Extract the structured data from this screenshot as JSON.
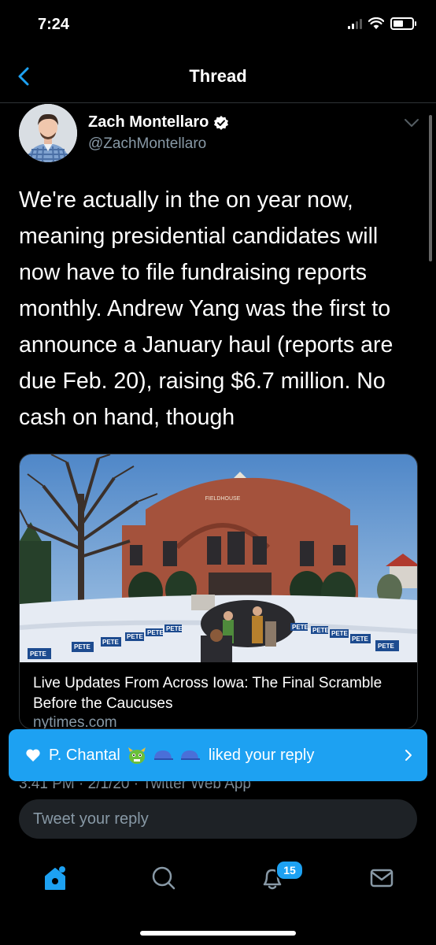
{
  "status_bar": {
    "time": "7:24"
  },
  "nav": {
    "title": "Thread"
  },
  "tweet": {
    "author_name": "Zach Montellaro",
    "author_handle": "@ZachMontellaro",
    "text": "We're actually in the on year now, meaning presidential candidates will now have to file fundraising reports monthly. Andrew Yang was the first to announce a January haul (reports are due Feb. 20), raising $6.7 million. No cash on hand, though",
    "meta": "3:41 PM · 2/1/20 · Twitter Web App"
  },
  "card": {
    "title": "Live Updates From Across Iowa: The Final Scramble Before the Caucuses",
    "domain": "nytimes.com",
    "image": {
      "building_sign": "FIELDHOUSE",
      "sign_text": "PETE"
    }
  },
  "toast": {
    "user": "P. Chantal",
    "action": "liked your reply"
  },
  "reply": {
    "placeholder": "Tweet your reply"
  },
  "tabs": [
    {
      "name": "home",
      "icon": "home-icon"
    },
    {
      "name": "search",
      "icon": "search-icon"
    },
    {
      "name": "notifications",
      "icon": "bell-icon",
      "badge": "15"
    },
    {
      "name": "messages",
      "icon": "mail-icon"
    }
  ],
  "colors": {
    "accent": "#1da1f2",
    "background": "#000000",
    "secondary_text": "#8899a6",
    "reply_bg": "#1e2226"
  }
}
